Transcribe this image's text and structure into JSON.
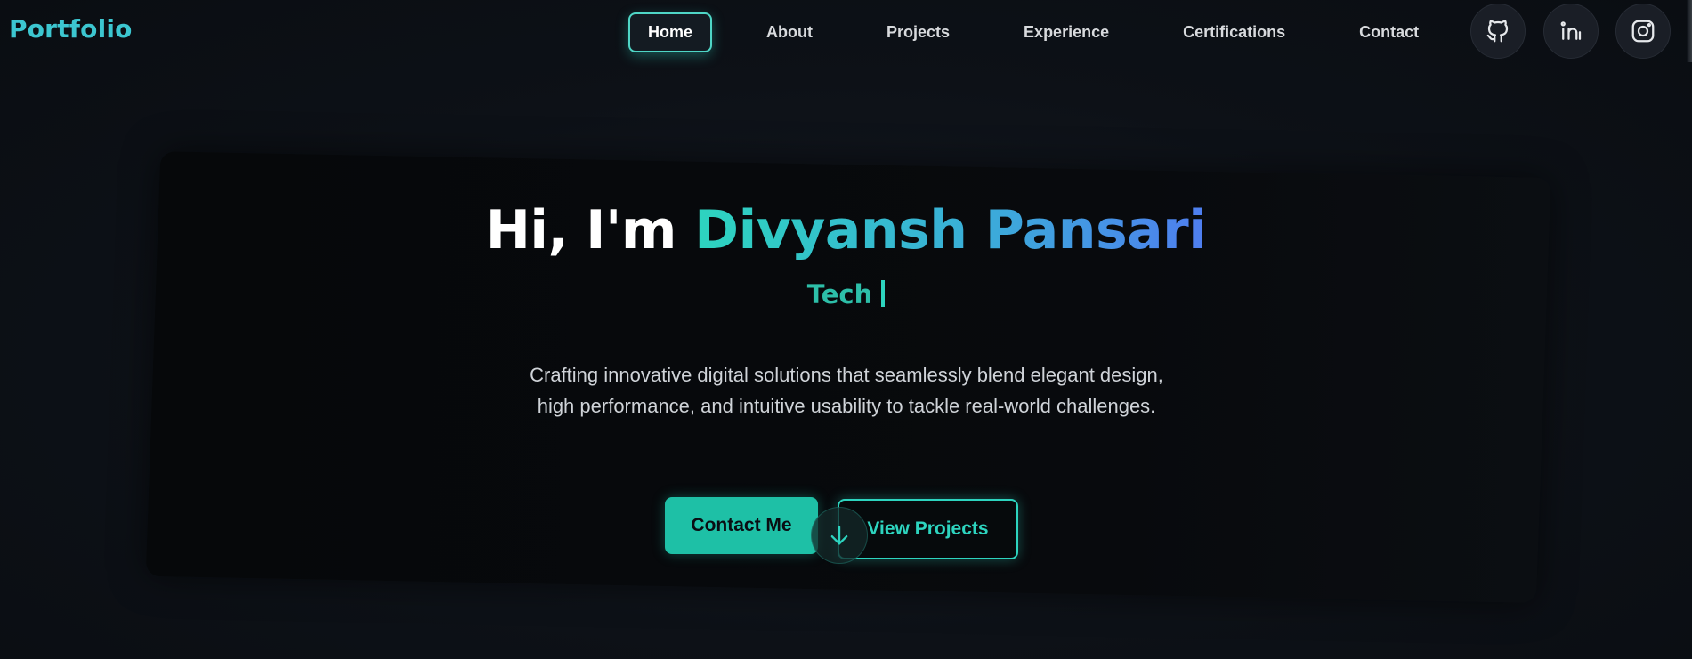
{
  "navbar": {
    "brand": "Portfolio",
    "links": [
      {
        "label": "Home",
        "active": true
      },
      {
        "label": "About"
      },
      {
        "label": "Projects"
      },
      {
        "label": "Experience"
      },
      {
        "label": "Certifications"
      },
      {
        "label": "Contact"
      }
    ],
    "social": [
      {
        "icon": "github-icon"
      },
      {
        "icon": "linkedin-icon"
      },
      {
        "icon": "instagram-icon"
      }
    ]
  },
  "hero": {
    "greeting": "Hi, I'm",
    "name": "Divyansh Pansari",
    "typed_text": "Tech",
    "description": "Crafting innovative digital solutions that seamlessly blend elegant design, high performance, and intuitive usability to tackle real-world challenges.",
    "primary_button": "Contact Me",
    "secondary_button": "View Projects",
    "scroll_icon": "arrow-down-icon"
  },
  "colors": {
    "accent": "#2dd4bf",
    "brand": "#3cc6d0",
    "gradient_end": "#4f7ef0",
    "background": "#0d1117"
  }
}
